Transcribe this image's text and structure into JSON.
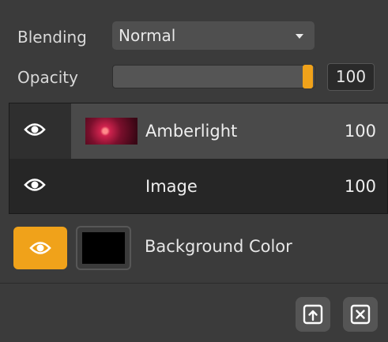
{
  "blending": {
    "label": "Blending",
    "value": "Normal"
  },
  "opacity": {
    "label": "Opacity",
    "value": "100",
    "level_percent": 100
  },
  "layers": [
    {
      "name": "Amberlight",
      "value": "100",
      "selected": true,
      "has_thumbnail": true
    },
    {
      "name": "Image",
      "value": "100",
      "selected": false,
      "has_thumbnail": false
    }
  ],
  "background": {
    "label": "Background Color",
    "color": "#000000",
    "eye_color": "#f0a21a"
  },
  "icons": {
    "eye": "eye-icon",
    "export": "export-icon",
    "close": "close-icon",
    "dropdown": "chevron-down-icon"
  }
}
